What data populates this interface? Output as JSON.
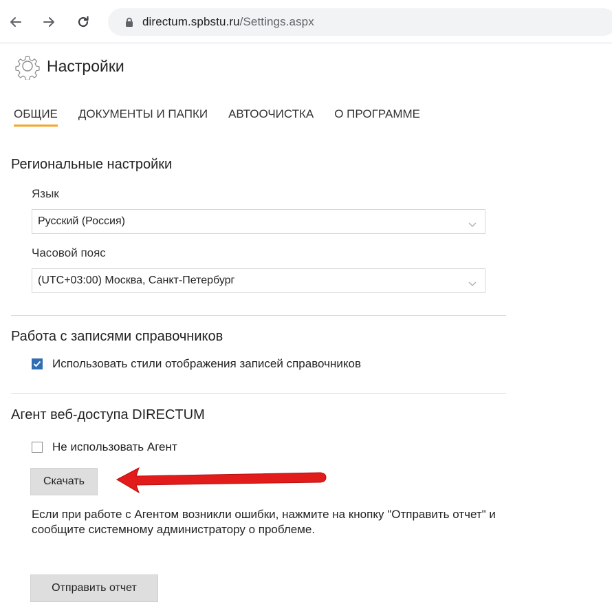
{
  "browser": {
    "url_host": "directum.spbstu.ru",
    "url_path": "/Settings.aspx",
    "back_icon": "arrow-left-icon",
    "forward_icon": "arrow-right-icon",
    "reload_icon": "reload-icon",
    "lock_icon": "lock-icon"
  },
  "page": {
    "title": "Настройки",
    "icon": "gear-icon"
  },
  "tabs": [
    {
      "label": "ОБЩИЕ",
      "active": true
    },
    {
      "label": "ДОКУМЕНТЫ И ПАПКИ",
      "active": false
    },
    {
      "label": "АВТООЧИСТКА",
      "active": false
    },
    {
      "label": "О ПРОГРАММЕ",
      "active": false
    }
  ],
  "regional": {
    "title": "Региональные настройки",
    "language_label": "Язык",
    "language_value": "Русский (Россия)",
    "timezone_label": "Часовой пояс",
    "timezone_value": "(UTC+03:00) Москва, Санкт-Петербург"
  },
  "directories": {
    "title": "Работа с записями справочников",
    "use_styles_label": "Использовать стили отображения записей справочников",
    "use_styles_checked": true
  },
  "agent": {
    "title": "Агент веб-доступа DIRECTUM",
    "no_agent_label": "Не использовать Агент",
    "no_agent_checked": false,
    "download_label": "Скачать",
    "help_text": "Если при работе с Агентом возникли ошибки, нажмите на кнопку \"Отправить отчет\" и сообщите системному администратору о проблеме.",
    "send_report_label": "Отправить отчет"
  },
  "colors": {
    "tab_accent": "#f6a623",
    "checkbox_accent": "#2f6db5",
    "annotation_arrow": "#e21b1b"
  }
}
